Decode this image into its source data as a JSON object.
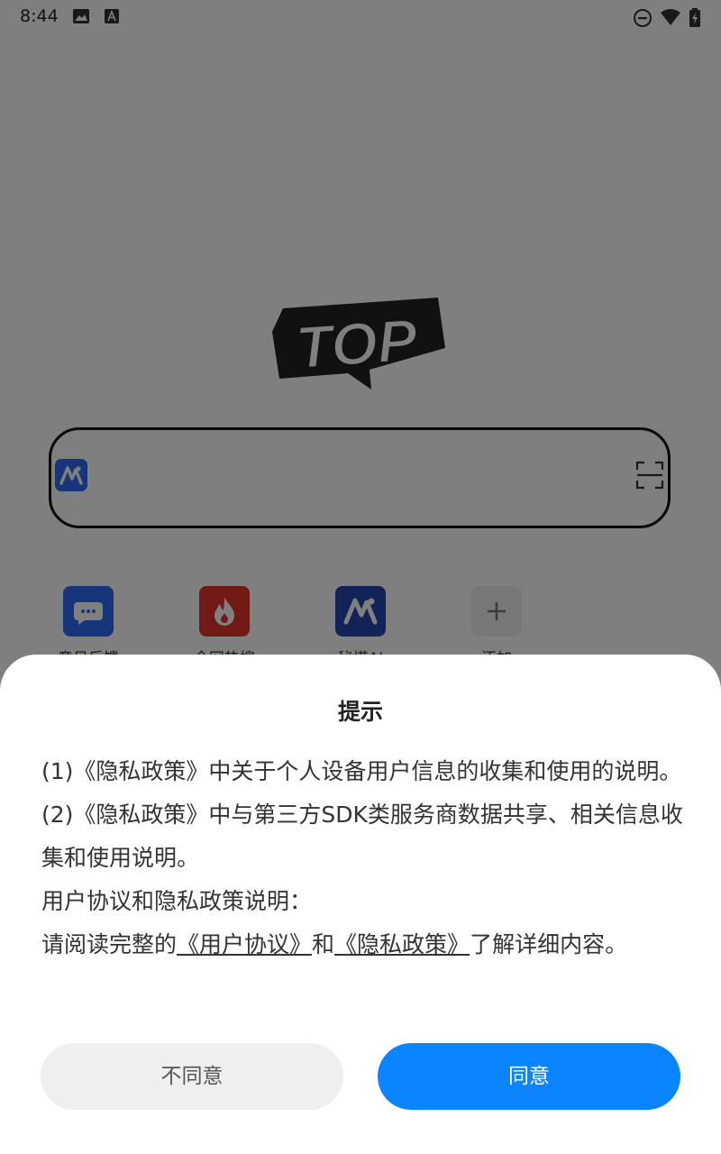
{
  "status_bar": {
    "time": "8:44",
    "icons": [
      "image-icon",
      "font-icon",
      "do-not-disturb-icon",
      "wifi-icon",
      "battery-icon"
    ]
  },
  "logo": {
    "text": "TOP"
  },
  "search": {
    "left_icon": "ai-icon",
    "right_icon": "scan-icon"
  },
  "quick_apps": [
    {
      "label": "意见反馈",
      "icon": "chat-icon",
      "color": "#2f6bf4"
    },
    {
      "label": "全网热搜",
      "icon": "fire-icon",
      "color": "#e2342b"
    },
    {
      "label": "秘塔AI",
      "icon": "ai-icon",
      "color": "#2446b0"
    },
    {
      "label": "添加",
      "icon": "plus-icon",
      "color": "#f0f0f0"
    }
  ],
  "dialog": {
    "title": "提示",
    "item1": "(1)《隐私政策》中关于个人设备用户信息的收集和使用的说明。",
    "item2": "(2)《隐私政策》中与第三方SDK类服务商数据共享、相关信息收集和使用说明。",
    "item3": "用户协议和隐私政策说明：",
    "item4": {
      "prefix": "请阅读完整的",
      "link1": "《用户协议》",
      "middle": "和",
      "link2": "《隐私政策》",
      "suffix": "了解详细内容。"
    },
    "disagree_label": "不同意",
    "agree_label": "同意"
  },
  "colors": {
    "agree_button": "#0a84ff",
    "disagree_button": "#efefef",
    "overlay": "rgba(0,0,0,0.5)"
  }
}
